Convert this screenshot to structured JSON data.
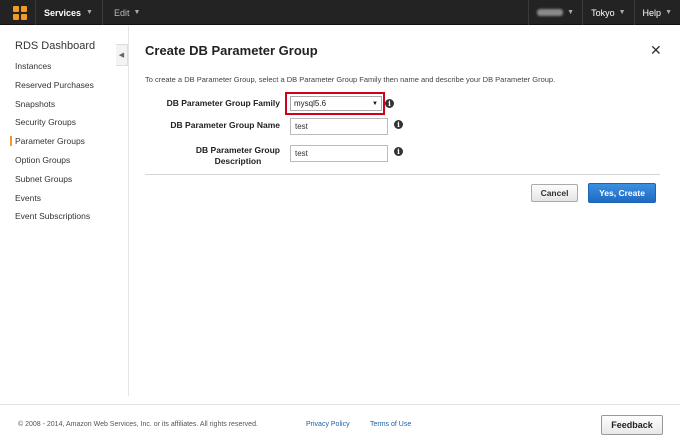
{
  "topnav": {
    "logo_icon": "aws-cube-icon",
    "services_label": "Services",
    "edit_label": "Edit",
    "region_label": "Tokyo",
    "help_label": "Help",
    "accent_color": "#f29a21"
  },
  "sidebar": {
    "title": "RDS Dashboard",
    "items": [
      {
        "label": "Instances",
        "active": false
      },
      {
        "label": "Reserved Purchases",
        "active": false
      },
      {
        "label": "Snapshots",
        "active": false
      },
      {
        "label": "Security Groups",
        "active": false
      },
      {
        "label": "Parameter Groups",
        "active": true
      },
      {
        "label": "Option Groups",
        "active": false
      },
      {
        "label": "Subnet Groups",
        "active": false
      },
      {
        "label": "Events",
        "active": false
      },
      {
        "label": "Event Subscriptions",
        "active": false
      }
    ]
  },
  "dialog": {
    "title": "Create DB Parameter Group",
    "close_symbol": "✕",
    "intro": "To create a DB Parameter Group, select a DB Parameter Group Family then name and describe your DB Parameter Group.",
    "fields": {
      "family_label": "DB Parameter Group Family",
      "family_value": "mysql5.6",
      "name_label": "DB Parameter Group Name",
      "name_value": "test",
      "description_label_line1": "DB Parameter Group",
      "description_label_line2": "Description",
      "description_value": "test"
    },
    "info_symbol": "i",
    "highlight_color": "#d0021b",
    "cancel_label": "Cancel",
    "create_label": "Yes, Create",
    "primary_color": "#1f6ac3"
  },
  "footer": {
    "copyright": "© 2008 - 2014, Amazon Web Services, Inc. or its affiliates. All rights reserved.",
    "privacy_label": "Privacy Policy",
    "terms_label": "Terms of Use",
    "feedback_label": "Feedback"
  }
}
